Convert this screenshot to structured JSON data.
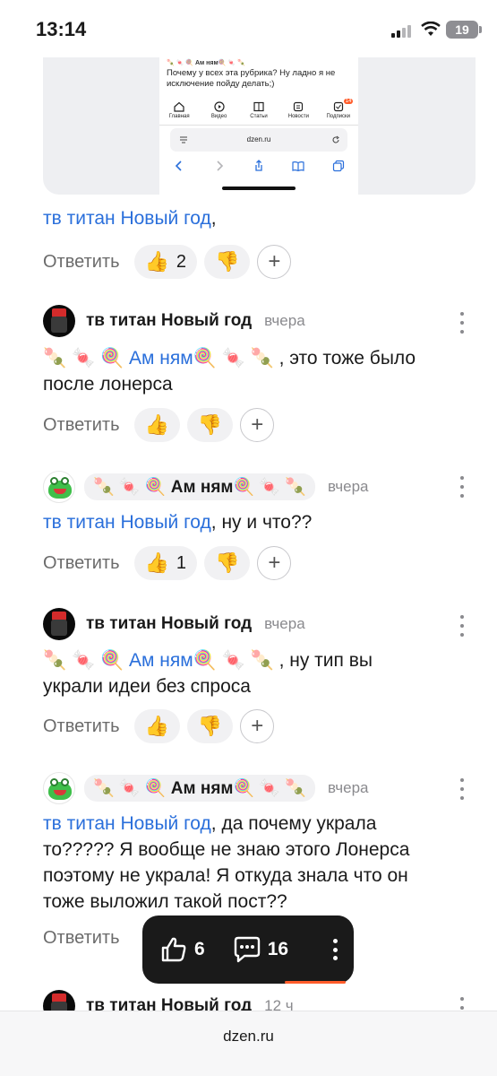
{
  "status": {
    "time": "13:14",
    "battery": "19"
  },
  "embed": {
    "header": "🍡 🍬 🍭 Ам ням🍭 🍬 🍡",
    "text": "Почему у всех эта рубрика? Ну ладно я не исключение пойду делать;)",
    "tabs": [
      {
        "label": "Главная",
        "icon": "home-icon"
      },
      {
        "label": "Видео",
        "icon": "video-icon"
      },
      {
        "label": "Статьи",
        "icon": "articles-icon"
      },
      {
        "label": "Новости",
        "icon": "news-icon"
      },
      {
        "label": "Подписки",
        "icon": "subscriptions-icon",
        "badge": "14"
      }
    ],
    "url": "dzen.ru"
  },
  "top_comment": {
    "mention": "тв титан Новый год",
    "text": ",",
    "reply": "Ответить",
    "likes": "2"
  },
  "comments": [
    {
      "author": "тв титан Новый год",
      "time": "вчера",
      "mention": "Ам ням",
      "line1_prefix": "🍡 🍬 🍭 ",
      "line1_suffix": "🍭 🍬 🍡 , это тоже было",
      "line2": "после лонерса",
      "reply": "Ответить",
      "likes": ""
    },
    {
      "author": "🍡 🍬 🍭 Ам ням🍭 🍬 🍡",
      "time": "вчера",
      "mention": "тв титан Новый год",
      "text": ", ну и что??",
      "reply": "Ответить",
      "likes": "1"
    },
    {
      "author": "тв титан Новый год",
      "time": "вчера",
      "mention": "Ам ням",
      "line1_prefix": "🍡 🍬 🍭 ",
      "line1_suffix": "🍭 🍬 🍡 , ну тип вы",
      "line2": "украли идеи без спроса",
      "reply": "Ответить",
      "likes": ""
    },
    {
      "author": "🍡 🍬 🍭 Ам ням🍭 🍬 🍡",
      "time": "вчера",
      "mention": "тв титан Новый год",
      "line1": ", да почему украла",
      "line2": "то????? Я вообще не знаю этого Лонерса",
      "line3": "поэтому не украла! Я откуда знала что он",
      "line4": "тоже выложил такой пост??",
      "reply": "Ответить"
    },
    {
      "author": "тв титан Новый год",
      "time": "12 ч"
    }
  ],
  "float_bar": {
    "likes": "6",
    "comments": "16"
  },
  "browser": {
    "url": "dzen.ru"
  }
}
